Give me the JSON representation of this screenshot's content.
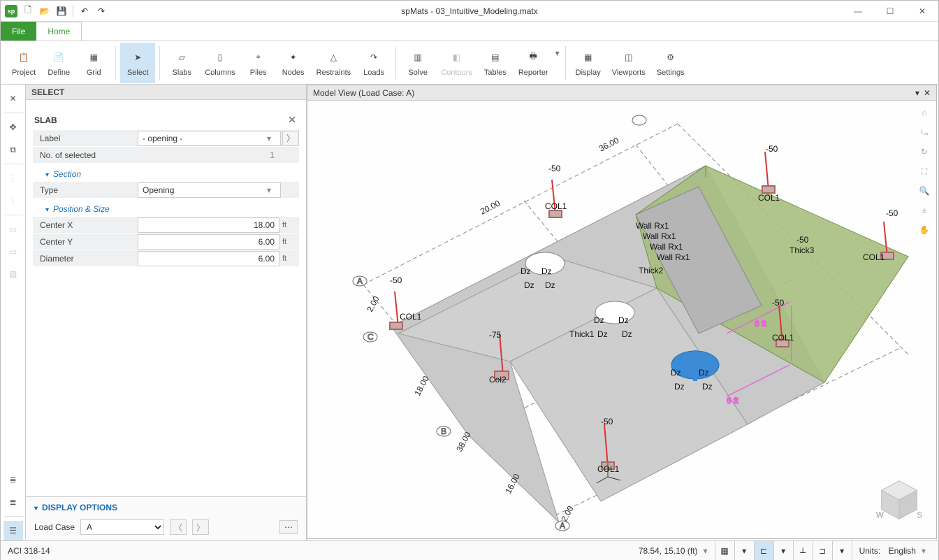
{
  "title": "spMats - 03_Intuitive_Modeling.matx",
  "tabs": {
    "file": "File",
    "home": "Home"
  },
  "ribbon": {
    "project": "Project",
    "define": "Define",
    "grid": "Grid",
    "select": "Select",
    "slabs": "Slabs",
    "columns": "Columns",
    "piles": "Piles",
    "nodes": "Nodes",
    "restraints": "Restraints",
    "loads": "Loads",
    "solve": "Solve",
    "contours": "Contours",
    "tables": "Tables",
    "reporter": "Reporter",
    "display": "Display",
    "viewports": "Viewports",
    "settings": "Settings"
  },
  "panel": {
    "header": "SELECT",
    "slab_header": "SLAB",
    "label_lbl": "Label",
    "label_val": "- opening -",
    "selected_lbl": "No. of selected",
    "selected_val": "1",
    "section_hdr": "Section",
    "type_lbl": "Type",
    "type_val": "Opening",
    "pos_hdr": "Position & Size",
    "cx_lbl": "Center X",
    "cx_val": "18.00",
    "cx_unit": "ft",
    "cy_lbl": "Center Y",
    "cy_val": "6.00",
    "cy_unit": "ft",
    "dia_lbl": "Diameter",
    "dia_val": "6.00",
    "dia_unit": "ft",
    "dopt_hdr": "DISPLAY OPTIONS",
    "lc_lbl": "Load Case",
    "lc_val": "A"
  },
  "view": {
    "header": "Model View (Load Case: A)"
  },
  "model": {
    "col1": "COL1",
    "col2": "Col2",
    "thick1": "Thick1",
    "thick2": "Thick2",
    "thick3": "Thick3",
    "wall": "Wall Rx1",
    "dz": "Dz",
    "m50": "-50",
    "m75": "-75",
    "dim6": "6 ft",
    "gridA": "A",
    "gridB": "B",
    "gridC": "C",
    "d2": "2.00",
    "d16": "16.00",
    "d18": "18.00",
    "d20": "20.00",
    "d36": "36.00",
    "d38": "38.00"
  },
  "status": {
    "code": "ACI 318-14",
    "coords": "78.54, 15.10 (ft)",
    "units_lbl": "Units:",
    "units_val": "English"
  }
}
